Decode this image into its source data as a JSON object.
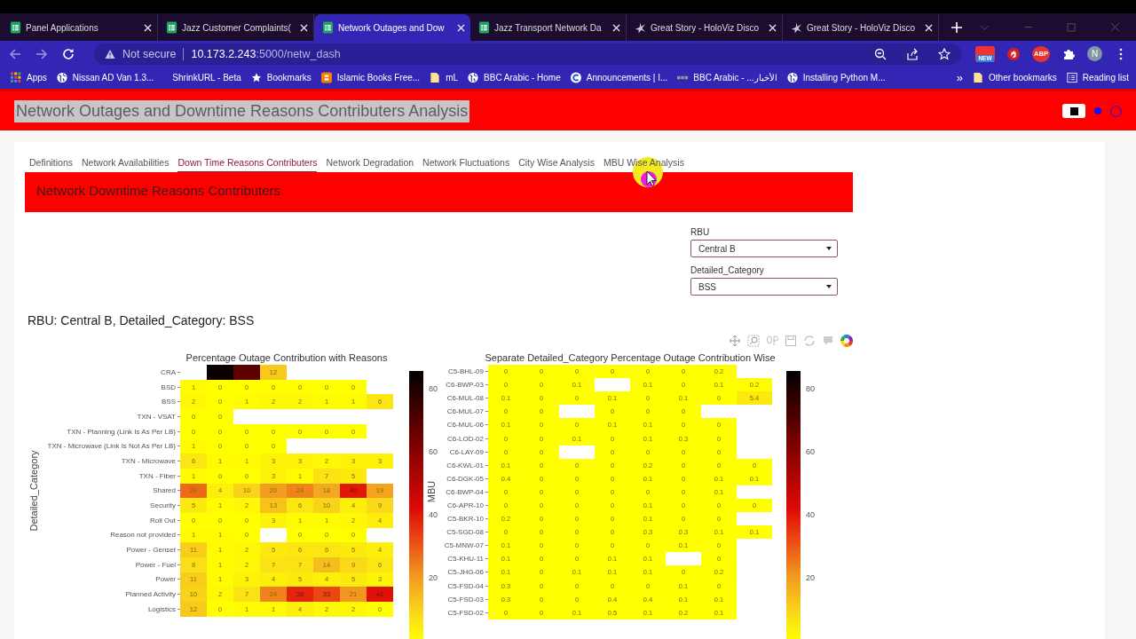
{
  "browser": {
    "tabs": [
      {
        "title": "Panel Applications",
        "kind": "sheets",
        "selected": false
      },
      {
        "title": "Jazz Customer Complaints(",
        "kind": "sheets",
        "selected": false
      },
      {
        "title": "Network Outages and Dow",
        "kind": "sheets",
        "selected": true
      },
      {
        "title": "Jazz Transport Network Da",
        "kind": "sheets",
        "selected": false
      },
      {
        "title": "Great Story - HoloViz Disco",
        "kind": "holoviz",
        "selected": false
      },
      {
        "title": "Great Story - HoloViz Disco",
        "kind": "holoviz",
        "selected": false
      }
    ],
    "security": "Not secure",
    "host": "10.173.2.243",
    "path": ":5000/netw_dash",
    "badge": "NEW",
    "adblock": "ABP",
    "avatar": "N",
    "bookmarks": [
      {
        "label": "Apps",
        "kind": "apps"
      },
      {
        "label": "Nissan AD Van 1.3...",
        "kind": "globe"
      },
      {
        "label": "ShrinkURL - Beta",
        "kind": "plain"
      },
      {
        "label": "Bookmarks",
        "kind": "star"
      },
      {
        "label": "Islamic Books Free...",
        "kind": "blogger"
      },
      {
        "label": "mL",
        "kind": "folder"
      },
      {
        "label": "BBC Arabic - Home",
        "kind": "globe"
      },
      {
        "label": "Announcements | I...",
        "kind": "c"
      },
      {
        "label": "BBC Arabic - ...الأخبار",
        "kind": "dots"
      },
      {
        "label": "Installing Python M...",
        "kind": "globe"
      }
    ],
    "overflow": "»",
    "other_bookmarks": "Other bookmarks",
    "reading_list": "Reading list"
  },
  "page": {
    "title": "Network Outages and Downtime Reasons Contributers Analysis",
    "tabs": [
      {
        "label": "Definitions",
        "selected": false
      },
      {
        "label": "Network Availabilities",
        "selected": false
      },
      {
        "label": "Down Time Reasons Contributers",
        "selected": true
      },
      {
        "label": "Network Degradation",
        "selected": false
      },
      {
        "label": "Network Fluctuations",
        "selected": false
      },
      {
        "label": "City Wise Analysis",
        "selected": false
      },
      {
        "label": "MBU Wise Analysis",
        "selected": false
      }
    ],
    "banner": "Network Downtime Reasons Contributers",
    "filters": [
      {
        "label": "RBU",
        "value": "Central B"
      },
      {
        "label": "Detailed_Category",
        "value": "BSS"
      }
    ],
    "heading": "RBU: Central B, Detailed_Category: BSS",
    "heatmaps": [
      {
        "title": "Percentage Outage Contribution with Reasons",
        "y_title": "Detailed_Category",
        "colorbar_ticks": [
          "80",
          "60",
          "40",
          "20"
        ],
        "rows": [
          {
            "label": "CRA",
            "cells": [
              null,
              {
                "color": "#0a0000"
              },
              {
                "color": "#5c0000"
              },
              "12",
              null,
              null,
              null,
              null
            ]
          },
          {
            "label": "BSD",
            "cells": [
              "1",
              "0",
              "0",
              "0",
              "0",
              "0",
              "0",
              null
            ]
          },
          {
            "label": "BSS",
            "cells": [
              "2",
              "0",
              "1",
              "2",
              "2",
              "1",
              "1",
              "6"
            ]
          },
          {
            "label": "TXN - VSAT",
            "cells": [
              "0",
              "0",
              null,
              null,
              null,
              null,
              null,
              null
            ]
          },
          {
            "label": "TXN - Planning (Link Is As Per LB)",
            "cells": [
              "0",
              "0",
              "0",
              "0",
              "0",
              "0",
              "0",
              null
            ]
          },
          {
            "label": "TXN - Microwave (Link Is Not As Per LB)",
            "cells": [
              "1",
              "0",
              "0",
              "0",
              null,
              null,
              null,
              null
            ]
          },
          {
            "label": "TXN - Microwave",
            "cells": [
              "6",
              "1",
              "1",
              "3",
              "3",
              "2",
              "3",
              "3"
            ]
          },
          {
            "label": "TXN - Fiber",
            "cells": [
              "1",
              "0",
              "0",
              "3",
              "1",
              "7",
              "5",
              null
            ]
          },
          {
            "label": "Shared",
            "cells": [
              "28",
              "4",
              "10",
              "20",
              "24",
              "18",
              "40",
              "19"
            ]
          },
          {
            "label": "Security",
            "cells": [
              "5",
              "1",
              "2",
              "13",
              "6",
              "10",
              "4",
              "9"
            ]
          },
          {
            "label": "Roll Out",
            "cells": [
              "0",
              "0",
              "0",
              "3",
              "1",
              "1",
              "2",
              "4"
            ]
          },
          {
            "label": "Reason not provided",
            "cells": [
              "1",
              "1",
              "0",
              null,
              "0",
              "0",
              "0",
              null
            ]
          },
          {
            "label": "Power - Genset",
            "cells": [
              "11",
              "1",
              "2",
              "5",
              "6",
              "6",
              "5",
              "4"
            ]
          },
          {
            "label": "Power - Fuel",
            "cells": [
              "8",
              "1",
              "2",
              "7",
              "7",
              "14",
              "9",
              "6"
            ]
          },
          {
            "label": "Power",
            "cells": [
              "11",
              "1",
              "3",
              "4",
              "5",
              "4",
              "5",
              "3"
            ]
          },
          {
            "label": "Planned Activity",
            "cells": [
              "10",
              "2",
              "7",
              "24",
              "38",
              "33",
              "21",
              "41"
            ]
          },
          {
            "label": "Logistics",
            "cells": [
              "12",
              "0",
              "1",
              "1",
              "4",
              "2",
              "2",
              "0"
            ]
          }
        ]
      },
      {
        "title": "Separate Detailed_Category Percentage Outage Contribution Wise",
        "y_title": "MBU",
        "colorbar_ticks": [
          "80",
          "60",
          "40",
          "20"
        ],
        "rows": [
          {
            "label": "C5-BHL-09",
            "cells": [
              "0",
              "0",
              "0",
              "0",
              "0",
              "0",
              "0.2",
              null
            ]
          },
          {
            "label": "C6-BWP-03",
            "cells": [
              "0",
              "0",
              "0.1",
              null,
              "0.1",
              "0",
              "0.1",
              "0.2"
            ]
          },
          {
            "label": "C6-MUL-08",
            "cells": [
              "0.1",
              "0",
              "0",
              "0.1",
              "0",
              "0.1",
              "0",
              "5.4"
            ]
          },
          {
            "label": "C6-MUL-07",
            "cells": [
              "0",
              "0",
              null,
              "0",
              "0",
              "0",
              null,
              null
            ]
          },
          {
            "label": "C6-MUL-06",
            "cells": [
              "0.1",
              "0",
              "0",
              "0.1",
              "0.1",
              "0",
              "0",
              null
            ]
          },
          {
            "label": "C6-LOD-02",
            "cells": [
              "0",
              "0",
              "0.1",
              "0",
              "0.1",
              "0.3",
              "0",
              null
            ]
          },
          {
            "label": "C6-LAY-09",
            "cells": [
              "0",
              "0",
              null,
              "0",
              "0",
              "0",
              "0",
              null
            ]
          },
          {
            "label": "C6-KWL-01",
            "cells": [
              "0.1",
              "0",
              "0",
              "0",
              "0.2",
              "0",
              "0",
              "0"
            ]
          },
          {
            "label": "C6-DGK-05",
            "cells": [
              "0.4",
              "0",
              "0",
              "0",
              "0.1",
              "0",
              "0.1",
              "0.1"
            ]
          },
          {
            "label": "C6-BWP-04",
            "cells": [
              "0",
              "0",
              "0",
              "0",
              "0",
              "0",
              "0.1",
              null
            ]
          },
          {
            "label": "C6-APR-10",
            "cells": [
              "0",
              "0",
              "0",
              "0",
              "0.1",
              "0",
              "0",
              "0"
            ]
          },
          {
            "label": "C5-BKR-10",
            "cells": [
              "0.2",
              "0",
              "0",
              "0",
              "0.1",
              "0",
              "0",
              null
            ]
          },
          {
            "label": "C5-SGD-08",
            "cells": [
              "0",
              "0",
              "0",
              "0",
              "0.3",
              "0.3",
              "0.1",
              "0.1"
            ]
          },
          {
            "label": "C5-MNW-07",
            "cells": [
              "0.1",
              "0",
              "0",
              "0",
              "0",
              "0.1",
              "0",
              null
            ]
          },
          {
            "label": "C5-KHU-11",
            "cells": [
              "0.1",
              "0",
              "0",
              "0.1",
              "0.1",
              null,
              "0",
              null
            ]
          },
          {
            "label": "C5-JHG-06",
            "cells": [
              "0.1",
              "0",
              "0.1",
              "0.1",
              "0.1",
              "0",
              "0.2",
              null
            ]
          },
          {
            "label": "C5-FSD-04",
            "cells": [
              "0.3",
              "0",
              "0",
              "0",
              "0",
              "0.1",
              "0",
              null
            ]
          },
          {
            "label": "C5-FSD-03",
            "cells": [
              "0.3",
              "0",
              "0",
              "0.4",
              "0.4",
              "0.1",
              "0.1",
              null
            ]
          },
          {
            "label": "C5-FSD-02",
            "cells": [
              "0",
              "0",
              "0.1",
              "0.5",
              "0.1",
              "0.2",
              "0.1",
              null
            ]
          }
        ]
      }
    ]
  }
}
